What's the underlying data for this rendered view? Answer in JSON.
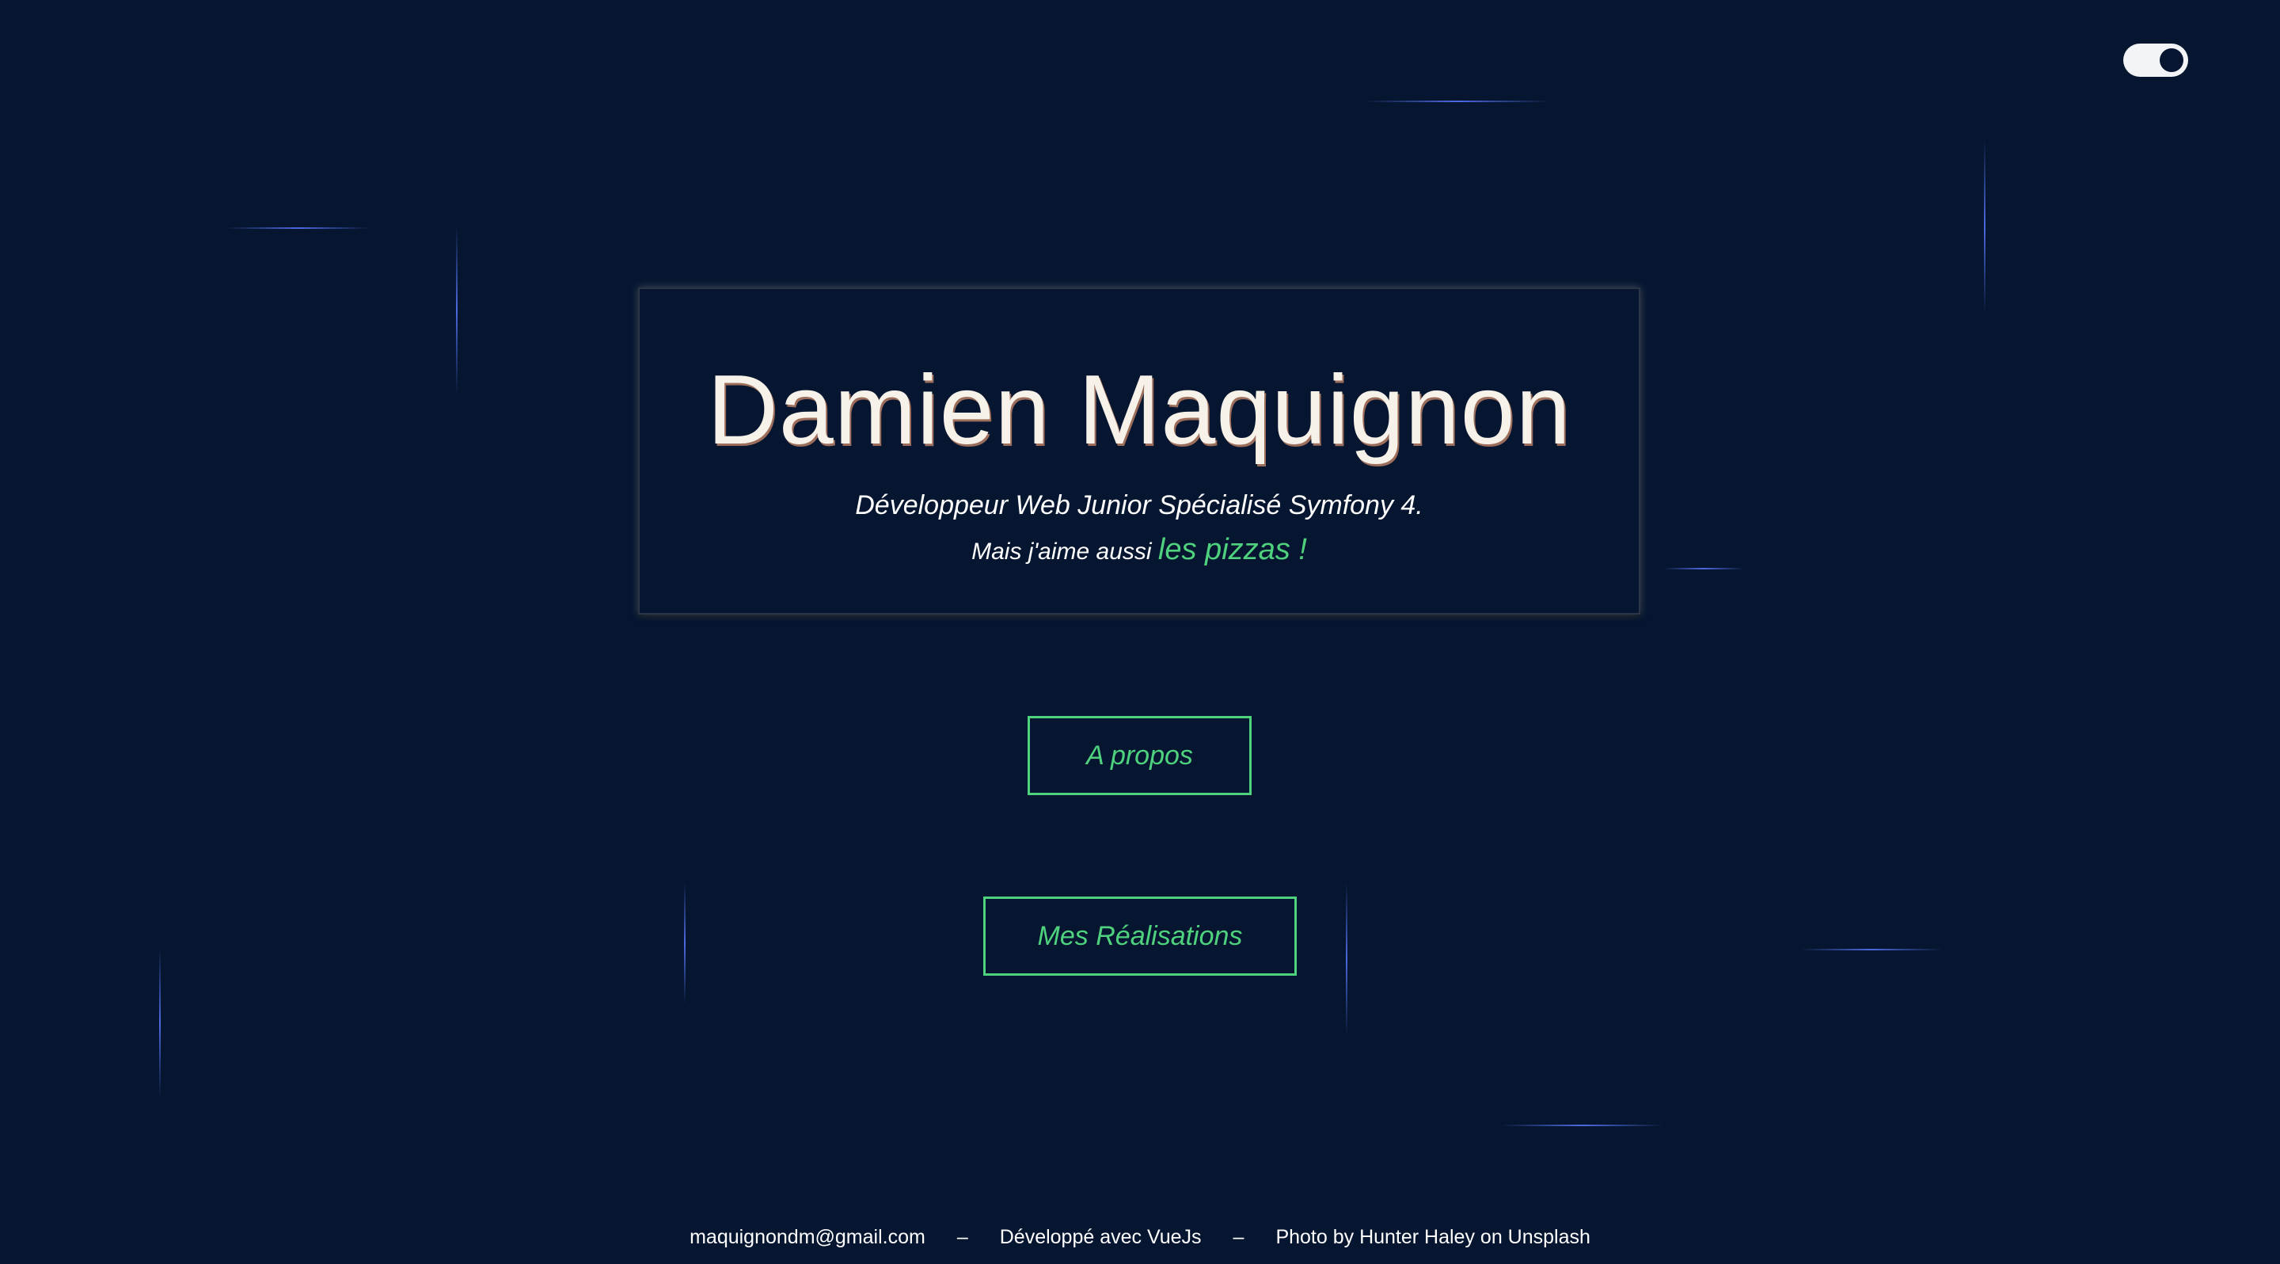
{
  "hero": {
    "title": "Damien Maquignon",
    "subtitle": "Développeur Web Junior Spécialisé Symfony 4.",
    "tagline_prefix": "Mais j'aime aussi",
    "tagline_accent": "les pizzas !"
  },
  "nav": {
    "about_label": "A propos",
    "works_label": "Mes Réalisations"
  },
  "theme_toggle": {
    "state": "dark"
  },
  "footer": {
    "email": "maquignondm@gmail.com",
    "separator": "–",
    "built_with": "Développé avec VueJs",
    "photo_credit": "Photo by Hunter Haley on Unsplash"
  },
  "colors": {
    "background": "#061630",
    "accent": "#4fd27e",
    "title_text": "#f6f1e9",
    "streak": "#5a78ff"
  }
}
